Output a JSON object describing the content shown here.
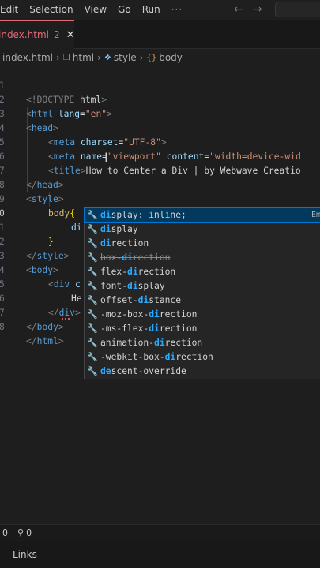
{
  "menubar": {
    "items": [
      "Edit",
      "Selection",
      "View",
      "Go",
      "Run"
    ],
    "more": "···",
    "back_icon": "arrow-left-icon",
    "forward_icon": "arrow-right-icon"
  },
  "tab": {
    "label": "index.html",
    "modified_count": "2",
    "close": "✕"
  },
  "breadcrumb": {
    "file": "index.html",
    "node1": "html",
    "node2": "style",
    "node3": "body"
  },
  "editor": {
    "line_numbers": [
      "1",
      "2",
      "3",
      "4",
      "5",
      "6",
      "7",
      "8",
      "9",
      "0",
      "1",
      "2",
      "3",
      "4",
      "5",
      "6",
      "7",
      "8"
    ],
    "l1": {
      "a": "<!DOCTYPE",
      "b": " html",
      "c": ">"
    },
    "l2": {
      "tag": "html",
      "attr": "lang",
      "val": "\"en\""
    },
    "l3": {
      "tag": "head"
    },
    "l4": {
      "tag": "meta",
      "attr": "charset",
      "val": "\"UTF-8\""
    },
    "l5": {
      "tag": "meta",
      "attr1": "name",
      "val1": "\"viewport\"",
      "attr2": "content",
      "val2": "\"width=device-wid"
    },
    "l6": {
      "tag": "title",
      "text": "How to Center a Div | by Webwave Creatio"
    },
    "l7": {
      "tag": "head"
    },
    "l8": {
      "tag": "style"
    },
    "l9": {
      "selector": "body",
      "brace": "{"
    },
    "l10": {
      "text": "di"
    },
    "l11": {
      "brace": "}"
    },
    "l12": {
      "tag": "style"
    },
    "l13": {
      "tag": "body"
    },
    "l14": {
      "tag": "div",
      "attr": "c"
    },
    "l15": {
      "text": "He"
    },
    "l16": {
      "tag": "div"
    },
    "l17": {
      "tag": "body"
    },
    "l18": {
      "tag": "html"
    }
  },
  "suggest": {
    "items": [
      {
        "pre": "",
        "hl": "di",
        "post": "splay: inline;",
        "strike": false
      },
      {
        "pre": "",
        "hl": "di",
        "post": "splay",
        "strike": false
      },
      {
        "pre": "",
        "hl": "di",
        "post": "rection",
        "strike": false
      },
      {
        "pre": "box-",
        "hl": "di",
        "post": "rection",
        "strike": true
      },
      {
        "pre": "flex-",
        "hl": "di",
        "post": "rection",
        "strike": false
      },
      {
        "pre": "font-",
        "hl": "di",
        "post": "splay",
        "strike": false
      },
      {
        "pre": "offset-",
        "hl": "di",
        "post": "stance",
        "strike": false
      },
      {
        "pre": "-moz-box-",
        "hl": "di",
        "post": "rection",
        "strike": false
      },
      {
        "pre": "-ms-flex-",
        "hl": "di",
        "post": "rection",
        "strike": false
      },
      {
        "pre": "animation-",
        "hl": "di",
        "post": "rection",
        "strike": false
      },
      {
        "pre": "-webkit-box-",
        "hl": "di",
        "post": "rection",
        "strike": false
      },
      {
        "pre": "",
        "hl": "de",
        "post": "scent-override",
        "strike": false
      }
    ],
    "detail": "Em",
    "icon": "wrench-icon"
  },
  "statusbar": {
    "errors": "0",
    "warnings": "0",
    "broadcast_icon": "broadcast-icon"
  },
  "bottom": {
    "links": "Links"
  }
}
